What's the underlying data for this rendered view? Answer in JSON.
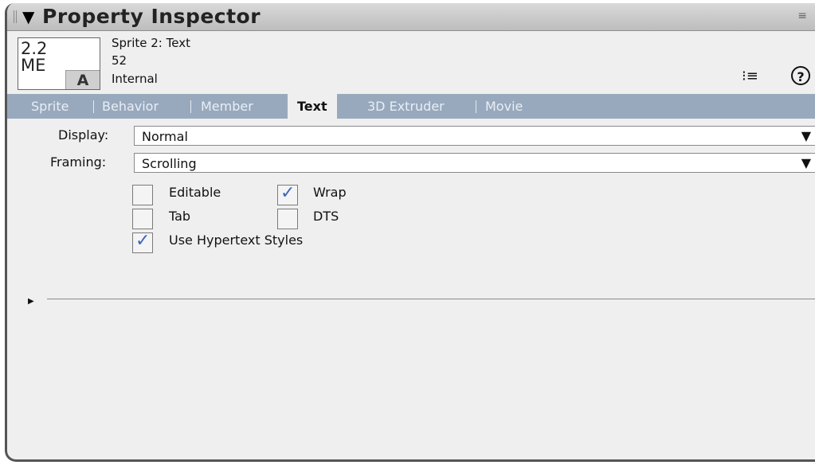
{
  "titlebar": {
    "title": "Property Inspector",
    "collapse_icon": "collapse-triangle",
    "grip_icon": "panel-grip",
    "options_icon": "options-menu",
    "options_glyph": "≡"
  },
  "sprite_info": {
    "thumbnail_text": "2.2\nME\n",
    "thumbnail_badge": "A",
    "name": "Sprite 2: Text",
    "number": "52",
    "cast": "Internal",
    "list_view_icon": "list-view",
    "list_view_glyph": "⁝≡",
    "help_icon": "help",
    "help_glyph": "?"
  },
  "tabs": [
    {
      "label": "Sprite",
      "active": false
    },
    {
      "label": "Behavior",
      "active": false
    },
    {
      "label": "Member",
      "active": false
    },
    {
      "label": "Text",
      "active": true
    },
    {
      "label": "3D Extruder",
      "active": false
    },
    {
      "label": "Movie",
      "active": false
    }
  ],
  "text_tab": {
    "display_label": "Display:",
    "display_value": "Normal",
    "framing_label": "Framing:",
    "framing_value": "Scrolling",
    "dropdown_arrow": "▼",
    "check_glyph": "✓",
    "checkboxes": {
      "editable": {
        "label": "Editable",
        "checked": false
      },
      "wrap": {
        "label": "Wrap",
        "checked": true
      },
      "tab": {
        "label": "Tab",
        "checked": false
      },
      "dts": {
        "label": "DTS",
        "checked": false
      },
      "hypertext": {
        "label": "Use Hypertext Styles",
        "checked": true
      }
    }
  },
  "expander_glyph": "▶",
  "colors": {
    "tab_bar": "#98a9be",
    "panel_bg": "#efefef",
    "check_mark": "#3f67b7"
  }
}
